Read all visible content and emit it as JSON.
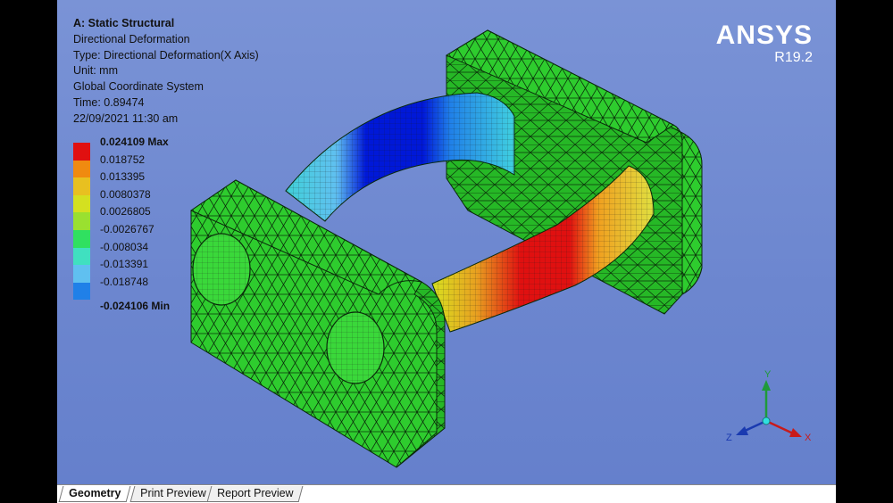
{
  "analysis": {
    "title": "A: Static Structural",
    "result_name": "Directional Deformation",
    "type": "Type: Directional Deformation(X Axis)",
    "unit": "Unit: mm",
    "coordinate_system": "Global Coordinate System",
    "time": "Time: 0.89474",
    "date": "22/09/2021 11:30 am"
  },
  "legend": {
    "values": [
      "0.024109 Max",
      "0.018752",
      "0.013395",
      "0.0080378",
      "0.0026805",
      "-0.0026767",
      "-0.008034",
      "-0.013391",
      "-0.018748",
      "-0.024106 Min"
    ],
    "colors": [
      "#e01010",
      "#f08a10",
      "#e8c020",
      "#d4e020",
      "#9ae030",
      "#30e060",
      "#40e0c0",
      "#60c0f0",
      "#2080e8",
      "#0010d0"
    ]
  },
  "brand": {
    "name": "ANSYS",
    "version": "R19.2"
  },
  "triad": {
    "x_label": "X",
    "y_label": "Y",
    "z_label": "Z"
  },
  "tabs": [
    {
      "label": "Geometry",
      "active": true
    },
    {
      "label": "Print Preview",
      "active": false
    },
    {
      "label": "Report Preview",
      "active": false
    }
  ],
  "colors": {
    "background": "#6c86cf",
    "mesh_green": "#2ecc2e",
    "mesh_lines": "#0a2a0a"
  }
}
